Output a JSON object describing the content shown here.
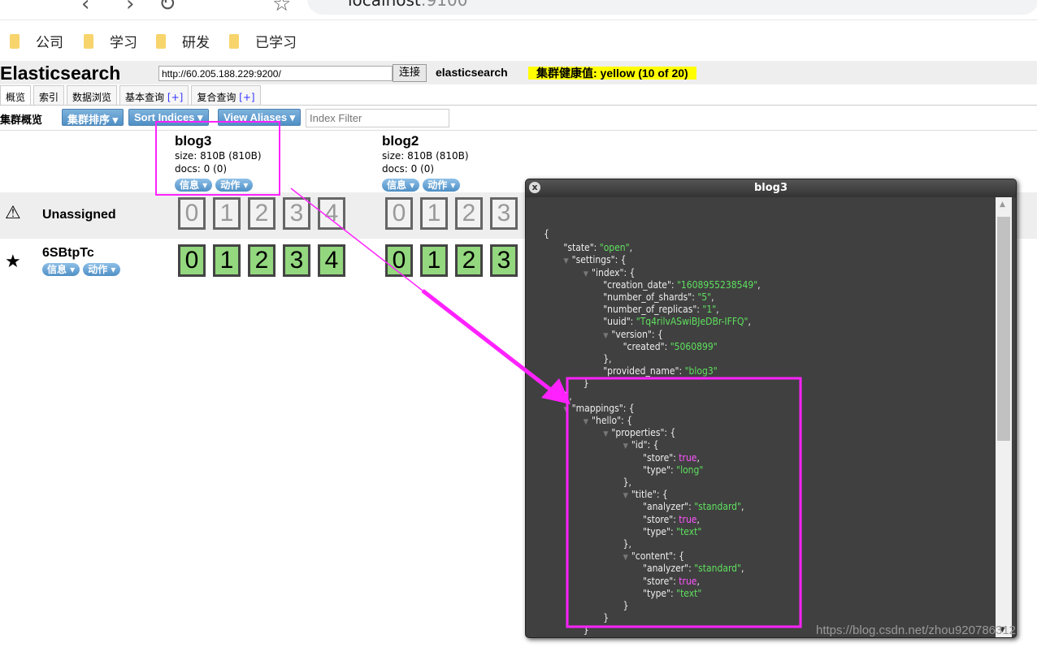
{
  "browser": {
    "address_host": "localhost",
    "address_port": ":9100",
    "bookmarks": [
      "公司",
      "学习",
      "研发",
      "已学习"
    ]
  },
  "header": {
    "logo": "Elasticsearch",
    "url": "http://60.205.188.229:9200/",
    "connect": "连接",
    "cluster_name": "elasticsearch",
    "health": "集群健康值: yellow (10 of 20)",
    "health_color": "#ffff00"
  },
  "tabs": [
    {
      "label": "概览"
    },
    {
      "label": "索引"
    },
    {
      "label": "数据浏览"
    },
    {
      "label": "基本查询",
      "plus": "[+]"
    },
    {
      "label": "复合查询",
      "plus": "[+]"
    }
  ],
  "toolbar": {
    "label": "集群概览",
    "sort_cluster": "集群排序 ▾",
    "sort_indices": "Sort Indices ▾",
    "view_aliases": "View Aliases ▾",
    "filter_placeholder": "Index Filter"
  },
  "indices": [
    {
      "name": "blog3",
      "size": "size: 810B (810B)",
      "docs": "docs: 0 (0)",
      "info": "信息 ▾",
      "action": "动作 ▾"
    },
    {
      "name": "blog2",
      "size": "size: 810B (810B)",
      "docs": "docs: 0 (0)",
      "info": "信息 ▾",
      "action": "动作 ▾"
    }
  ],
  "rows": [
    {
      "name": "Unassigned",
      "icon": "warning-icon",
      "shards": [
        "0",
        "1",
        "2",
        "3",
        "4"
      ],
      "state": "unassigned"
    },
    {
      "name": "6SBtpTc",
      "icon": "star-icon",
      "info": "信息 ▾",
      "action": "动作 ▾",
      "shards": [
        "0",
        "1",
        "2",
        "3",
        "4"
      ],
      "state": "assigned",
      "color": "#93d77e"
    }
  ],
  "modal": {
    "title": "blog3",
    "lines": [
      {
        "l": 0,
        "k": "{"
      },
      {
        "l": 1,
        "k": "\"state\": ",
        "v": "\"open\"",
        "vt": "s",
        "e": ","
      },
      {
        "l": 1,
        "t": 1,
        "k": "\"settings\": {"
      },
      {
        "l": 2,
        "t": 1,
        "k": "\"index\": {"
      },
      {
        "l": 3,
        "k": "\"creation_date\": ",
        "v": "\"1608955238549\"",
        "vt": "s",
        "e": ","
      },
      {
        "l": 3,
        "k": "\"number_of_shards\": ",
        "v": "\"5\"",
        "vt": "s",
        "e": ","
      },
      {
        "l": 3,
        "k": "\"number_of_replicas\": ",
        "v": "\"1\"",
        "vt": "s",
        "e": ","
      },
      {
        "l": 3,
        "k": "\"uuid\": ",
        "v": "\"Tq4rilvASwiBJeDBr-IFFQ\"",
        "vt": "s",
        "e": ","
      },
      {
        "l": 3,
        "t": 1,
        "k": "\"version\": {"
      },
      {
        "l": 4,
        "k": "\"created\": ",
        "v": "\"5060899\"",
        "vt": "s"
      },
      {
        "l": 3,
        "k": "},"
      },
      {
        "l": 3,
        "k": "\"provided_name\": ",
        "v": "\"blog3\"",
        "vt": "s"
      },
      {
        "l": 2,
        "k": "}"
      },
      {
        "l": 1,
        "k": "},"
      },
      {
        "l": 1,
        "t": 1,
        "k": "\"mappings\": {"
      },
      {
        "l": 2,
        "t": 1,
        "k": "\"hello\": {"
      },
      {
        "l": 3,
        "t": 1,
        "k": "\"properties\": {"
      },
      {
        "l": 4,
        "t": 1,
        "k": "\"id\": {"
      },
      {
        "l": 5,
        "k": "\"store\": ",
        "v": "true",
        "vt": "b",
        "e": ","
      },
      {
        "l": 5,
        "k": "\"type\": ",
        "v": "\"long\"",
        "vt": "s"
      },
      {
        "l": 4,
        "k": "},"
      },
      {
        "l": 4,
        "t": 1,
        "k": "\"title\": {"
      },
      {
        "l": 5,
        "k": "\"analyzer\": ",
        "v": "\"standard\"",
        "vt": "s",
        "e": ","
      },
      {
        "l": 5,
        "k": "\"store\": ",
        "v": "true",
        "vt": "b",
        "e": ","
      },
      {
        "l": 5,
        "k": "\"type\": ",
        "v": "\"text\"",
        "vt": "s"
      },
      {
        "l": 4,
        "k": "},"
      },
      {
        "l": 4,
        "t": 1,
        "k": "\"content\": {"
      },
      {
        "l": 5,
        "k": "\"analyzer\": ",
        "v": "\"standard\"",
        "vt": "s",
        "e": ","
      },
      {
        "l": 5,
        "k": "\"store\": ",
        "v": "true",
        "vt": "b",
        "e": ","
      },
      {
        "l": 5,
        "k": "\"type\": ",
        "v": "\"text\"",
        "vt": "s"
      },
      {
        "l": 4,
        "k": "}"
      },
      {
        "l": 3,
        "k": "}"
      },
      {
        "l": 2,
        "k": "}"
      },
      {
        "l": 1,
        "k": "},"
      }
    ]
  },
  "annotation_color": "#ff22ff",
  "watermark": "https://blog.csdn.net/zhou920786312"
}
